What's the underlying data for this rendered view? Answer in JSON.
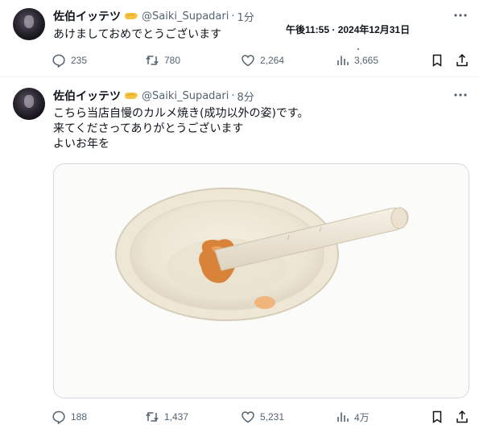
{
  "tweets": [
    {
      "display_name": "佐伯イッテツ",
      "handle": "@Saiki_Supadari",
      "separator": "·",
      "time": "1分",
      "lines": [
        "あけましておめでとうございます"
      ],
      "actions": {
        "replies": "235",
        "reposts": "780",
        "likes": "2,264",
        "views": "3,665"
      }
    },
    {
      "display_name": "佐伯イッテツ",
      "handle": "@Saiki_Supadari",
      "separator": "·",
      "time": "8分",
      "lines": [
        "こちら当店自慢のカルメ焼き(成功以外の姿)です。",
        "来てくださってありがとうございます",
        "よいお年を"
      ],
      "actions": {
        "replies": "188",
        "reposts": "1,437",
        "likes": "5,231",
        "views": "4万"
      }
    }
  ],
  "overlay_date": "午後11:55 · 2024年12月31日",
  "colors": {
    "text": "#0f1419",
    "secondary": "#536471",
    "border": "#cfd9de",
    "badge": "#f5c242"
  },
  "icons": [
    "reply-icon",
    "repost-icon",
    "like-icon",
    "views-icon",
    "bookmark-icon",
    "share-icon",
    "more-icon",
    "verified-badge-icon"
  ]
}
